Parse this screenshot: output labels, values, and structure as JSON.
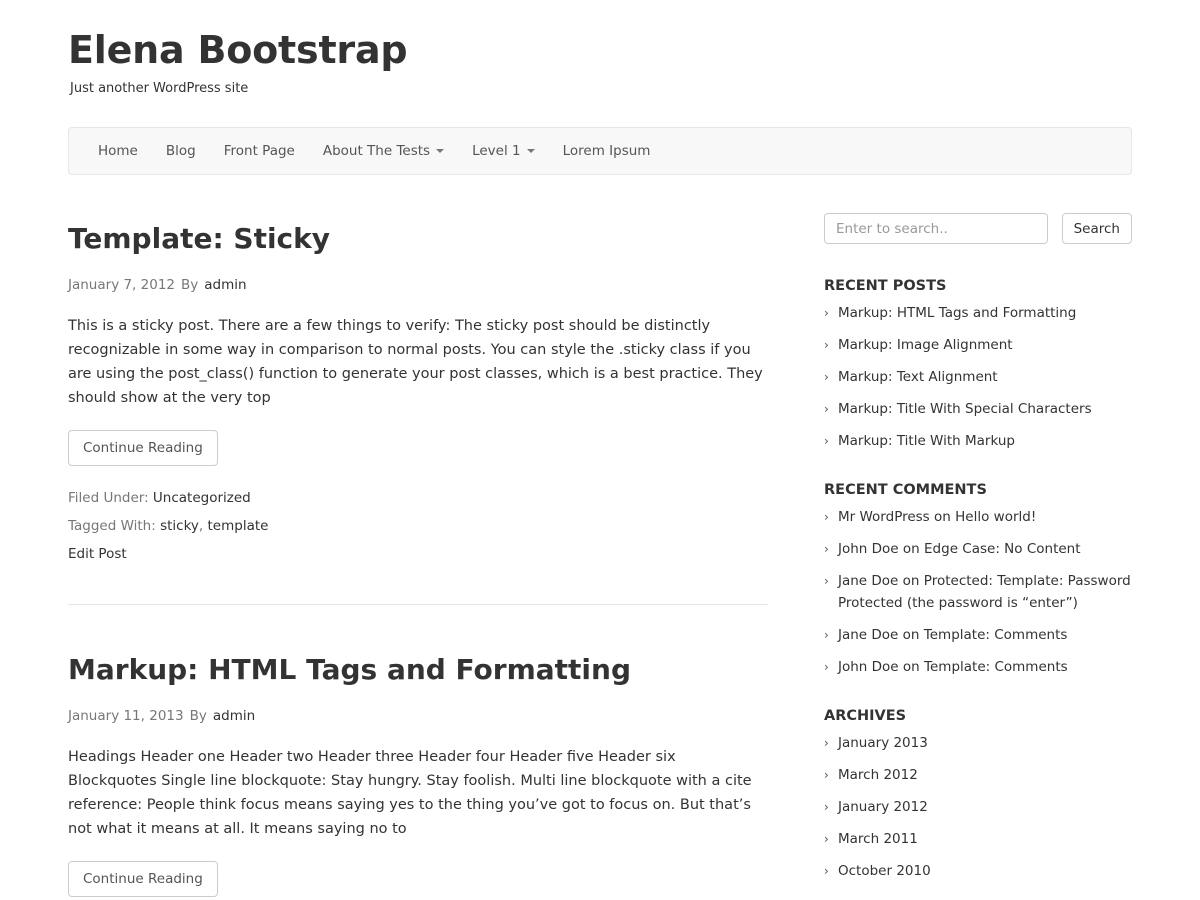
{
  "site": {
    "title": "Elena Bootstrap",
    "description": "Just another WordPress site"
  },
  "nav": {
    "items": [
      {
        "label": "Home",
        "dropdown": false
      },
      {
        "label": "Blog",
        "dropdown": false
      },
      {
        "label": "Front Page",
        "dropdown": false
      },
      {
        "label": "About The Tests",
        "dropdown": true
      },
      {
        "label": "Level 1",
        "dropdown": true
      },
      {
        "label": "Lorem Ipsum",
        "dropdown": false
      }
    ]
  },
  "posts": [
    {
      "title": "Template: Sticky",
      "date": "January 7, 2012",
      "by": "By",
      "author": "admin",
      "excerpt": "This is a sticky post. There are a few things to verify: The sticky post should be distinctly recognizable in some way in comparison to normal posts. You can style the .sticky class if you are using the post_class() function to generate your post classes, which is a best practice. They should show at the very top",
      "button": "Continue Reading",
      "filed_label": "Filed Under:",
      "category": "Uncategorized",
      "tagged_label": "Tagged With:",
      "tags": [
        "sticky",
        "template"
      ],
      "tag_sep": ",",
      "edit": "Edit Post"
    },
    {
      "title": "Markup: HTML Tags and Formatting",
      "date": "January 11, 2013",
      "by": "By",
      "author": "admin",
      "excerpt": "Headings Header one Header two Header three Header four Header five Header six Blockquotes Single line blockquote: Stay hungry. Stay foolish. Multi line blockquote with a cite reference: People think focus means saying yes to the thing you’ve got to focus on. But that’s not what it means at all. It means saying no to",
      "button": "Continue Reading"
    }
  ],
  "sidebar": {
    "search": {
      "placeholder": "Enter to search..",
      "button": "Search"
    },
    "recent_posts": {
      "title": "RECENT POSTS",
      "items": [
        "Markup: HTML Tags and Formatting",
        "Markup: Image Alignment",
        "Markup: Text Alignment",
        "Markup: Title With Special Characters",
        "Markup: Title With Markup"
      ]
    },
    "recent_comments": {
      "title": "RECENT COMMENTS",
      "on": "on",
      "items": [
        {
          "author": "Mr WordPress",
          "post": "Hello world!"
        },
        {
          "author": "John Doe",
          "post": "Edge Case: No Content"
        },
        {
          "author": "Jane Doe",
          "post": "Protected: Template: Password Protected (the password is “enter”)"
        },
        {
          "author": "Jane Doe",
          "post": "Template: Comments"
        },
        {
          "author": "John Doe",
          "post": "Template: Comments"
        }
      ]
    },
    "archives": {
      "title": "ARCHIVES",
      "items": [
        "January 2013",
        "March 2012",
        "January 2012",
        "March 2011",
        "October 2010"
      ]
    }
  },
  "icons": {
    "list_bullet": "chevron-right-icon",
    "dropdown": "caret-down-icon"
  }
}
